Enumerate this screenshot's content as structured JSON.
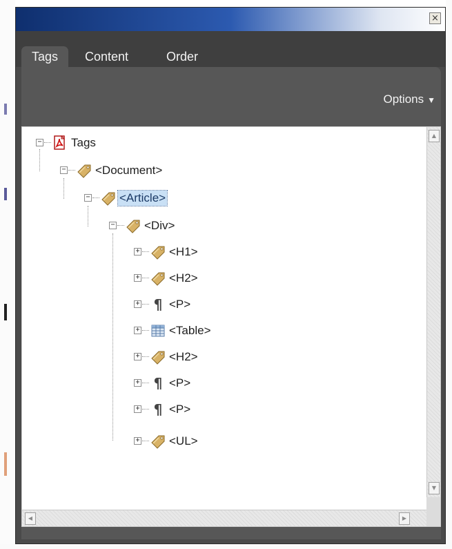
{
  "window": {
    "close_glyph": "×"
  },
  "tabs": [
    {
      "label": "Tags",
      "active": true
    },
    {
      "label": "Content",
      "active": false
    },
    {
      "label": "Order",
      "active": false
    }
  ],
  "toolbar": {
    "options_label": "Options",
    "options_caret": "▼"
  },
  "tree": {
    "root": {
      "label": "Tags",
      "icon": "pdf-tags-icon",
      "toggle": "−"
    },
    "document": {
      "label": "<Document>",
      "icon": "tag-icon",
      "toggle": "−"
    },
    "article": {
      "label": "<Article>",
      "icon": "tag-icon",
      "toggle": "−",
      "selected": true
    },
    "div": {
      "label": "<Div>",
      "icon": "tag-icon",
      "toggle": "−"
    },
    "children": [
      {
        "label": "<H1>",
        "icon": "tag-icon",
        "toggle": "+"
      },
      {
        "label": "<H2>",
        "icon": "tag-icon",
        "toggle": "+"
      },
      {
        "label": "<P>",
        "icon": "paragraph-icon",
        "toggle": "+"
      },
      {
        "label": "<Table>",
        "icon": "table-icon",
        "toggle": "+"
      },
      {
        "label": "<H2>",
        "icon": "tag-icon",
        "toggle": "+"
      },
      {
        "label": "<P>",
        "icon": "paragraph-icon",
        "toggle": "+"
      },
      {
        "label": "<P>",
        "icon": "paragraph-icon",
        "toggle": "+"
      },
      {
        "label": "<UL>",
        "icon": "tag-icon",
        "toggle": "+"
      }
    ]
  },
  "scrollbars": {
    "up": "▲",
    "down": "▼",
    "left": "◀",
    "right": "▶"
  },
  "colors": {
    "title_dark": "#0f2f6e",
    "title_mid": "#2c5ab0",
    "panel": "#4a4a4a",
    "tab_active": "#575757",
    "selection": "#c9e0f5",
    "tag_icon": "#c9a25a"
  }
}
